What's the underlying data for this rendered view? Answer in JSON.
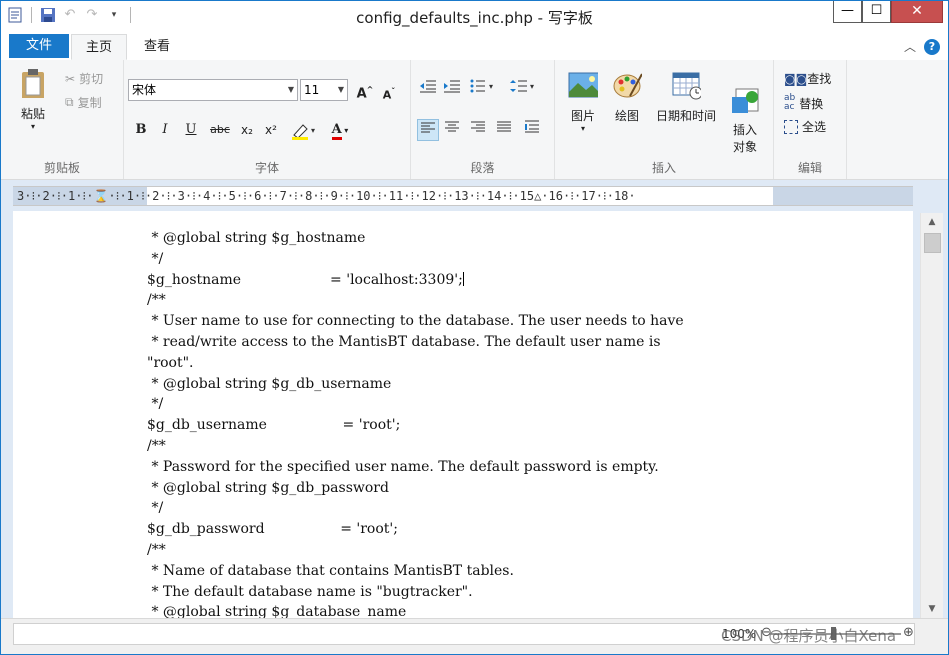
{
  "window": {
    "title": "config_defaults_inc.php - 写字板",
    "controls": {
      "minimize": "—",
      "maximize": "☐",
      "close": "✕"
    }
  },
  "quick_access": [
    "app-icon",
    "save-icon",
    "undo-icon",
    "redo-icon",
    "customize-icon"
  ],
  "tabs": {
    "file": "文件",
    "home": "主页",
    "view": "查看"
  },
  "ribbon": {
    "clipboard": {
      "label": "剪贴板",
      "paste": "粘贴",
      "cut": "剪切",
      "copy": "复制"
    },
    "font": {
      "label": "字体",
      "family": "宋体",
      "size": "11",
      "grow": "A",
      "shrink": "A",
      "bold": "B",
      "italic": "I",
      "underline": "U",
      "strike": "abc",
      "subscript": "x₂",
      "superscript": "x²",
      "text_color": "A"
    },
    "paragraph": {
      "label": "段落"
    },
    "insert": {
      "label": "插入",
      "picture": "图片",
      "paint": "绘图",
      "datetime": "日期和时间",
      "object": "插入\n对象"
    },
    "editing": {
      "label": "编辑",
      "find": "查找",
      "replace": "替换",
      "select_all": "全选"
    }
  },
  "ruler": "3·⁝·2·⁝·1·⁝·⌛·⁝·1·⁝·2·⁝·3·⁝·4·⁝·5·⁝·6·⁝·7·⁝·8·⁝·9·⁝·10·⁝·11·⁝·12·⁝·13·⁝·14·⁝·15△·16·⁝·17·⁝·18·",
  "document": {
    "lines_a": [
      " * @global string $g_hostname",
      " */",
      "$g_hostname                    = 'localhost:3309';"
    ],
    "lines_b": [
      "/**",
      " * User name to use for connecting to the database. The user needs to have",
      " * read/write access to the MantisBT database. The default user name is",
      "\"root\".",
      " * @global string $g_db_username",
      " */",
      "$g_db_username                 = 'root';",
      "/**",
      " * Password for the specified user name. The default password is empty.",
      " * @global string $g_db_password",
      " */",
      "$g_db_password                 = 'root';",
      "/**",
      " * Name of database that contains MantisBT tables.",
      " * The default database name is \"bugtracker\".",
      " * @global string $g_database_name"
    ]
  },
  "status": {
    "zoom": "100%",
    "watermark": "CSDN @程序员小白Xena"
  }
}
